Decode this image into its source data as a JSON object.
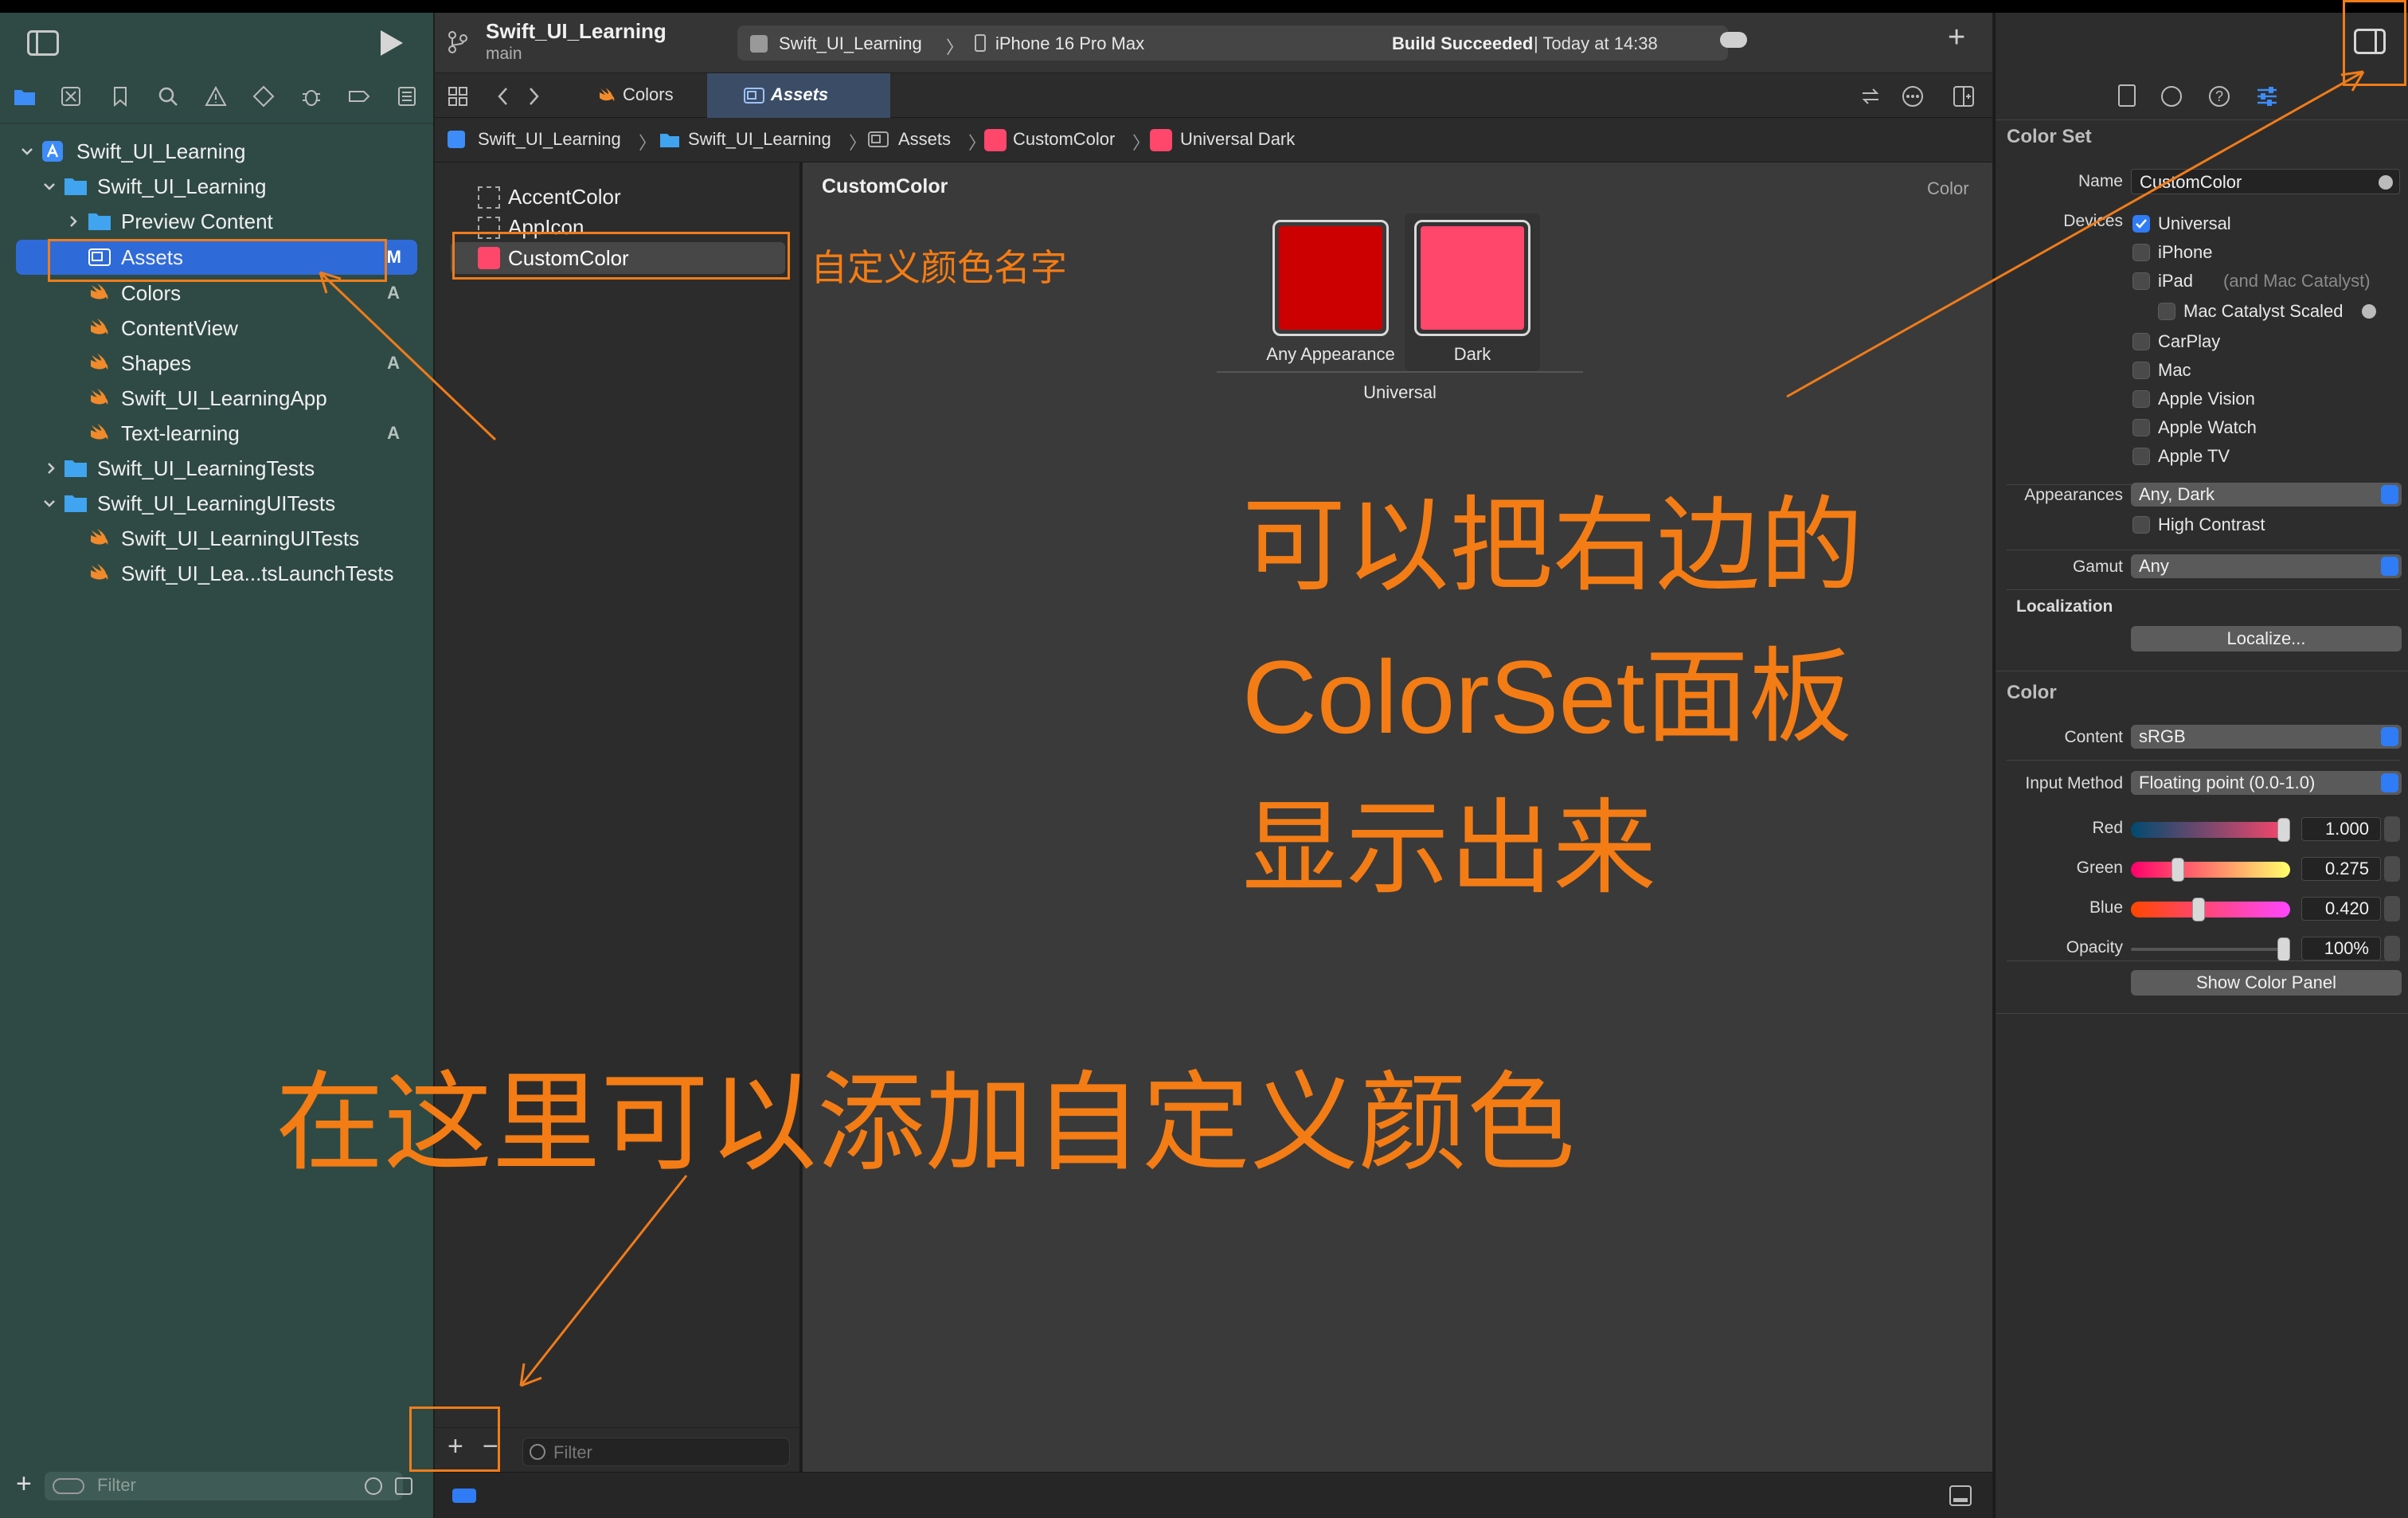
{
  "navigator": {
    "filter_placeholder": "Filter",
    "tree": [
      {
        "label": "Swift_UI_Learning",
        "badge": ""
      },
      {
        "label": "Swift_UI_Learning",
        "badge": ""
      },
      {
        "label": "Preview Content",
        "badge": ""
      },
      {
        "label": "Assets",
        "badge": "M"
      },
      {
        "label": "Colors",
        "badge": "A"
      },
      {
        "label": "ContentView",
        "badge": ""
      },
      {
        "label": "Shapes",
        "badge": "A"
      },
      {
        "label": "Swift_UI_LearningApp",
        "badge": ""
      },
      {
        "label": "Text-learning",
        "badge": "A"
      },
      {
        "label": "Swift_UI_LearningTests",
        "badge": ""
      },
      {
        "label": "Swift_UI_LearningUITests",
        "badge": ""
      },
      {
        "label": "Swift_UI_LearningUITests",
        "badge": ""
      },
      {
        "label": "Swift_UI_Lea...tsLaunchTests",
        "badge": ""
      }
    ]
  },
  "toolbar": {
    "project": "Swift_UI_Learning",
    "branch": "main",
    "scheme": "Swift_UI_Learning",
    "scheme_sep": "〉",
    "device": "iPhone 16 Pro Max",
    "status_bold": "Build Succeeded",
    "status_rest": " | Today at 14:38"
  },
  "tabs": [
    {
      "label": "Colors"
    },
    {
      "label": "Assets"
    }
  ],
  "jumpbar": [
    "Swift_UI_Learning",
    "Swift_UI_Learning",
    "Assets",
    "CustomColor",
    "Universal Dark"
  ],
  "asset_list": {
    "items": [
      "AccentColor",
      "AppIcon",
      "CustomColor"
    ],
    "filter_placeholder": "Filter"
  },
  "detail": {
    "title": "CustomColor",
    "kind": "Color",
    "swatches": [
      {
        "label": "Any Appearance",
        "color": "#cc0000"
      },
      {
        "label": "Dark",
        "color": "#ff466b"
      }
    ],
    "group_label": "Universal"
  },
  "inspector": {
    "section_colorset": "Color Set",
    "name_label": "Name",
    "name_value": "CustomColor",
    "devices_label": "Devices",
    "devices": [
      {
        "label": "Universal",
        "checked": true,
        "note": ""
      },
      {
        "label": "iPhone",
        "checked": false,
        "note": ""
      },
      {
        "label": "iPad",
        "checked": false,
        "note": "(and Mac Catalyst)"
      },
      {
        "label": "Mac Catalyst Scaled",
        "checked": false,
        "note": ""
      },
      {
        "label": "CarPlay",
        "checked": false,
        "note": ""
      },
      {
        "label": "Mac",
        "checked": false,
        "note": ""
      },
      {
        "label": "Apple Vision",
        "checked": false,
        "note": ""
      },
      {
        "label": "Apple Watch",
        "checked": false,
        "note": ""
      },
      {
        "label": "Apple TV",
        "checked": false,
        "note": ""
      }
    ],
    "appearances_label": "Appearances",
    "appearances_value": "Any, Dark",
    "high_contrast": "High Contrast",
    "gamut_label": "Gamut",
    "gamut_value": "Any",
    "localization_label": "Localization",
    "localize_button": "Localize...",
    "section_color": "Color",
    "content_label": "Content",
    "content_value": "sRGB",
    "input_method_label": "Input Method",
    "input_method_value": "Floating point (0.0-1.0)",
    "components": [
      {
        "label": "Red",
        "value": "1.000",
        "level": 1.0
      },
      {
        "label": "Green",
        "value": "0.275",
        "level": 0.275
      },
      {
        "label": "Blue",
        "value": "0.420",
        "level": 0.42
      },
      {
        "label": "Opacity",
        "value": "100%",
        "level": 1.0
      }
    ],
    "show_color_panel": "Show Color Panel"
  },
  "annotations": {
    "custom_color_name": "自定义颜色名字",
    "show_panel_1": "可以把右边的",
    "show_panel_2": "ColorSet面板",
    "show_panel_3": "显示出来",
    "add_here": "在这里可以添加自定义颜色"
  },
  "colors": {
    "accent": "#2f7cf6",
    "annotation": "#f07c1a",
    "navigator_bg": "#2f4a44"
  }
}
